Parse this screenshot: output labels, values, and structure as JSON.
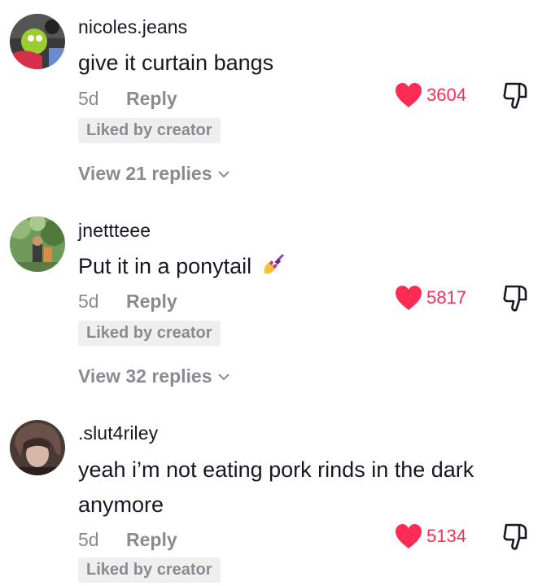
{
  "colors": {
    "accent": "#fe2c55",
    "muted": "#8a8b91",
    "text": "#161823",
    "badge_bg": "#efeff0"
  },
  "comments": [
    {
      "username": "nicoles.jeans",
      "text": "give it curtain bangs",
      "time": "5d",
      "reply_label": "Reply",
      "likes": "3604",
      "liked_badge": "Liked by creator",
      "view_replies": "View 21 replies"
    },
    {
      "username": "jnettteee",
      "text": "Put it in a ponytail",
      "emoji_icon": "nail-polish-icon",
      "time": "5d",
      "reply_label": "Reply",
      "likes": "5817",
      "liked_badge": "Liked by creator",
      "view_replies": "View 32 replies"
    },
    {
      "username": ".slut4riley",
      "text": "yeah i’m not eating pork rinds in the dark anymore",
      "time": "5d",
      "reply_label": "Reply",
      "likes": "5134",
      "liked_badge": "Liked by creator"
    }
  ]
}
